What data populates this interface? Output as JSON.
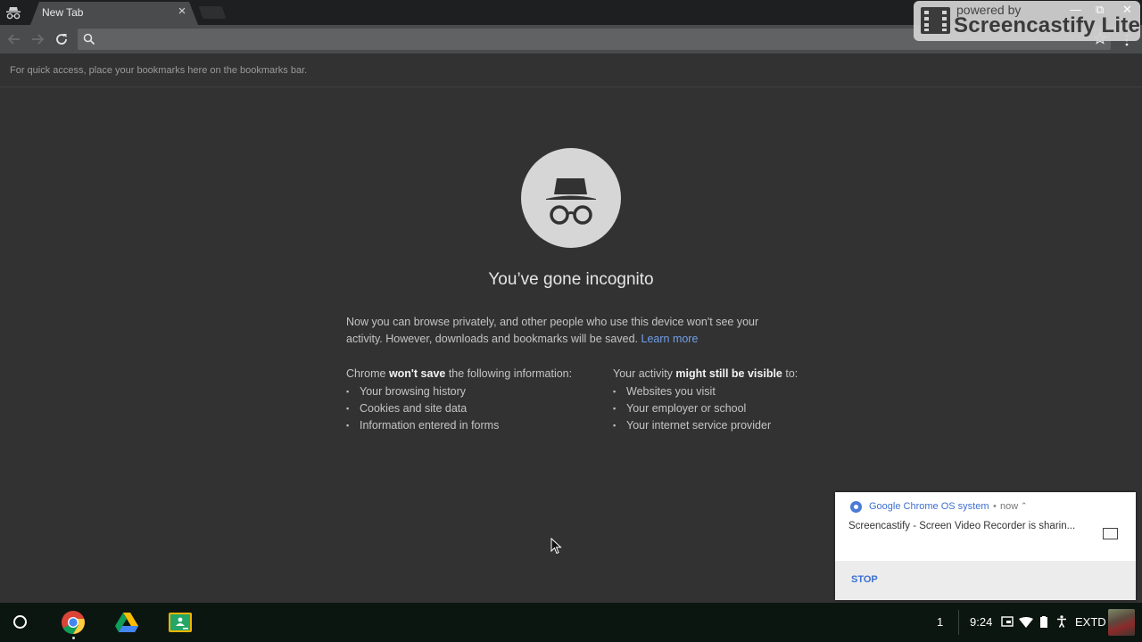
{
  "browser": {
    "tab": {
      "title": "New Tab",
      "close_label": "×"
    },
    "omnibox": {
      "value": "",
      "placeholder": ""
    },
    "bookmarks_hint": "For quick access, place your bookmarks here on the bookmarks bar."
  },
  "watermark": {
    "powered": "powered by",
    "brand": "Screencastify Lite",
    "min": "—",
    "restore": "⧉",
    "close": "✕"
  },
  "incognito": {
    "headline": "You’ve gone incognito",
    "intro": "Now you can browse privately, and other people who use this device won't see your activity. However, downloads and bookmarks will be saved.",
    "learn_more": "Learn more",
    "left": {
      "pre": "Chrome ",
      "bold": "won't save",
      "post": " the following information:",
      "items": [
        "Your browsing history",
        "Cookies and site data",
        "Information entered in forms"
      ]
    },
    "right": {
      "pre": "Your activity ",
      "bold": "might still be visible",
      "post": " to:",
      "items": [
        "Websites you visit",
        "Your employer or school",
        "Your internet service provider"
      ]
    }
  },
  "notification": {
    "source": "Google Chrome OS system",
    "sep": "•",
    "time": "now",
    "expand": "⌃",
    "message": "Screencastify - Screen Video Recorder is sharin...",
    "action": "STOP"
  },
  "shelf": {
    "apps": [
      "chrome-icon",
      "drive-icon",
      "classroom-icon"
    ],
    "tray": {
      "notification_count": "1",
      "time": "9:24",
      "ime": "EXTD"
    }
  },
  "colors": {
    "link": "#6f9fe8",
    "notif_accent": "#3c6fd1"
  }
}
